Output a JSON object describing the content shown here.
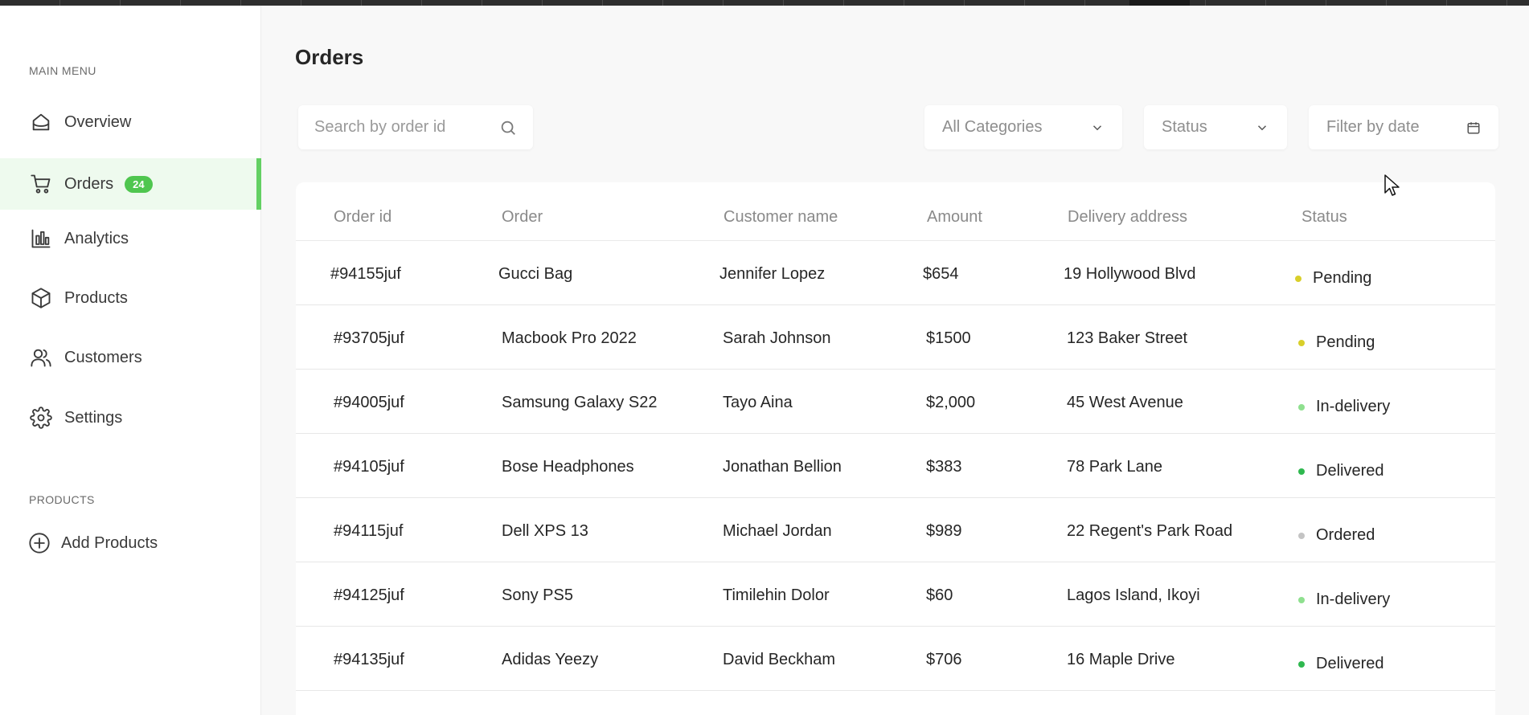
{
  "sidebar": {
    "main_menu_label": "MAIN MENU",
    "items": [
      {
        "label": "Overview",
        "icon": "home-icon"
      },
      {
        "label": "Orders",
        "icon": "cart-icon",
        "badge": "24",
        "active": true
      },
      {
        "label": "Analytics",
        "icon": "bar-chart-icon"
      },
      {
        "label": "Products",
        "icon": "box-icon"
      },
      {
        "label": "Customers",
        "icon": "users-icon"
      },
      {
        "label": "Settings",
        "icon": "gear-icon"
      }
    ],
    "products_label": "PRODUCTS",
    "add_products_label": "Add Products"
  },
  "page": {
    "title": "Orders"
  },
  "filters": {
    "search_placeholder": "Search by order id",
    "categories_value": "All Categories",
    "status_value": "Status",
    "date_placeholder": "Filter by date"
  },
  "table": {
    "columns": [
      "Order id",
      "Order",
      "Customer name",
      "Amount",
      "Delivery address",
      "Status"
    ],
    "rows": [
      {
        "id": "#94155juf",
        "order": "Gucci Bag",
        "customer": "Jennifer Lopez",
        "amount": "$654",
        "address": "19 Hollywood Blvd",
        "status": "Pending"
      },
      {
        "id": "#93705juf",
        "order": "Macbook Pro 2022",
        "customer": "Sarah Johnson",
        "amount": "$1500",
        "address": "123 Baker Street",
        "status": "Pending"
      },
      {
        "id": "#94005juf",
        "order": "Samsung Galaxy S22",
        "customer": "Tayo Aina",
        "amount": "$2,000",
        "address": "45 West Avenue",
        "status": "In-delivery"
      },
      {
        "id": "#94105juf",
        "order": "Bose Headphones",
        "customer": "Jonathan Bellion",
        "amount": "$383",
        "address": "78 Park Lane",
        "status": "Delivered"
      },
      {
        "id": "#94115juf",
        "order": "Dell XPS 13",
        "customer": "Michael Jordan",
        "amount": "$989",
        "address": "22 Regent's Park Road",
        "status": "Ordered"
      },
      {
        "id": "#94125juf",
        "order": "Sony PS5",
        "customer": "Timilehin Dolor",
        "amount": "$60",
        "address": "Lagos Island, Ikoyi",
        "status": "In-delivery"
      },
      {
        "id": "#94135juf",
        "order": "Adidas Yeezy",
        "customer": "David Beckham",
        "amount": "$706",
        "address": "16 Maple Drive",
        "status": "Delivered"
      }
    ]
  },
  "status_colors": {
    "Pending": "#d9cf2a",
    "In-delivery": "#8fe08f",
    "Delivered": "#2fb84f",
    "Ordered": "#c4c4c4"
  },
  "colors": {
    "accent": "#63d063",
    "badge": "#4fc64f",
    "active_bg": "#eefaee"
  }
}
